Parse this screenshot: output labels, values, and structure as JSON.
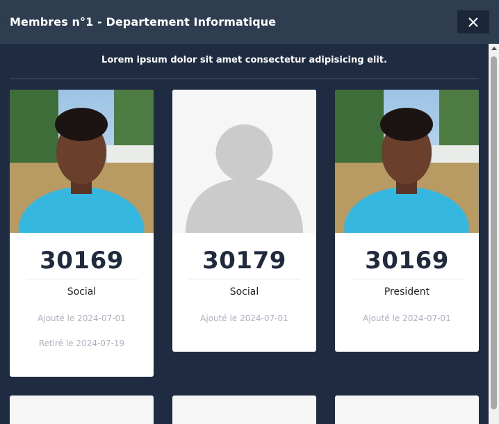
{
  "modal": {
    "title": "Membres n°1 - Departement Informatique",
    "close_icon": "close-icon",
    "subtitle": "Lorem ipsum dolor sit amet consectetur adipisicing elit."
  },
  "members": [
    {
      "photo": "member-photo",
      "number": "30169",
      "role": "Social",
      "added": "Ajouté le 2024-07-01",
      "removed": "Retiré le 2024-07-19"
    },
    {
      "photo": "avatar-placeholder-icon",
      "number": "30179",
      "role": "Social",
      "added": "Ajouté le 2024-07-01",
      "removed": ""
    },
    {
      "photo": "member-photo",
      "number": "30169",
      "role": "President",
      "added": "Ajouté le 2024-07-01",
      "removed": ""
    }
  ],
  "colors": {
    "background": "#1e2b40",
    "header": "#2f3d51",
    "card": "#ffffff",
    "number": "#1f2a3d",
    "muted": "#a9b1c1"
  }
}
